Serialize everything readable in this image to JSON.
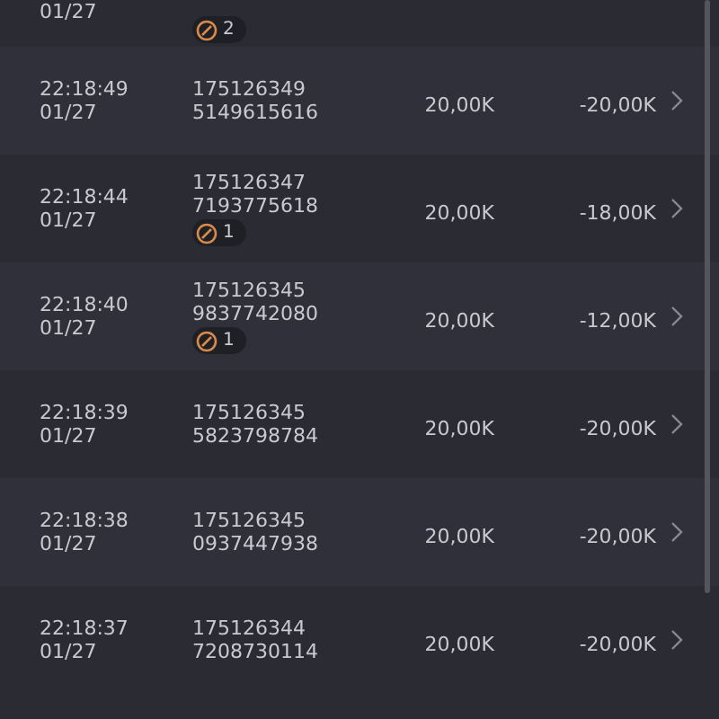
{
  "partial_row": {
    "date": "01/27",
    "badge": "2"
  },
  "rows": [
    {
      "time": "22:18:49",
      "date": "01/27",
      "id_line_1": "175126349",
      "id_line_2": "5149615616",
      "amount": "20,00K",
      "change": "-20,00K"
    },
    {
      "time": "22:18:44",
      "date": "01/27",
      "id_line_1": "175126347",
      "id_line_2": "7193775618",
      "badge": "1",
      "amount": "20,00K",
      "change": "-18,00K"
    },
    {
      "time": "22:18:40",
      "date": "01/27",
      "id_line_1": "175126345",
      "id_line_2": "9837742080",
      "badge": "1",
      "amount": "20,00K",
      "change": "-12,00K"
    },
    {
      "time": "22:18:39",
      "date": "01/27",
      "id_line_1": "175126345",
      "id_line_2": "5823798784",
      "amount": "20,00K",
      "change": "-20,00K"
    },
    {
      "time": "22:18:38",
      "date": "01/27",
      "id_line_1": "175126345",
      "id_line_2": "0937447938",
      "amount": "20,00K",
      "change": "-20,00K"
    },
    {
      "time": "22:18:37",
      "date": "01/27",
      "id_line_1": "175126344",
      "id_line_2": "7208730114",
      "amount": "20,00K",
      "change": "-20,00K"
    }
  ]
}
